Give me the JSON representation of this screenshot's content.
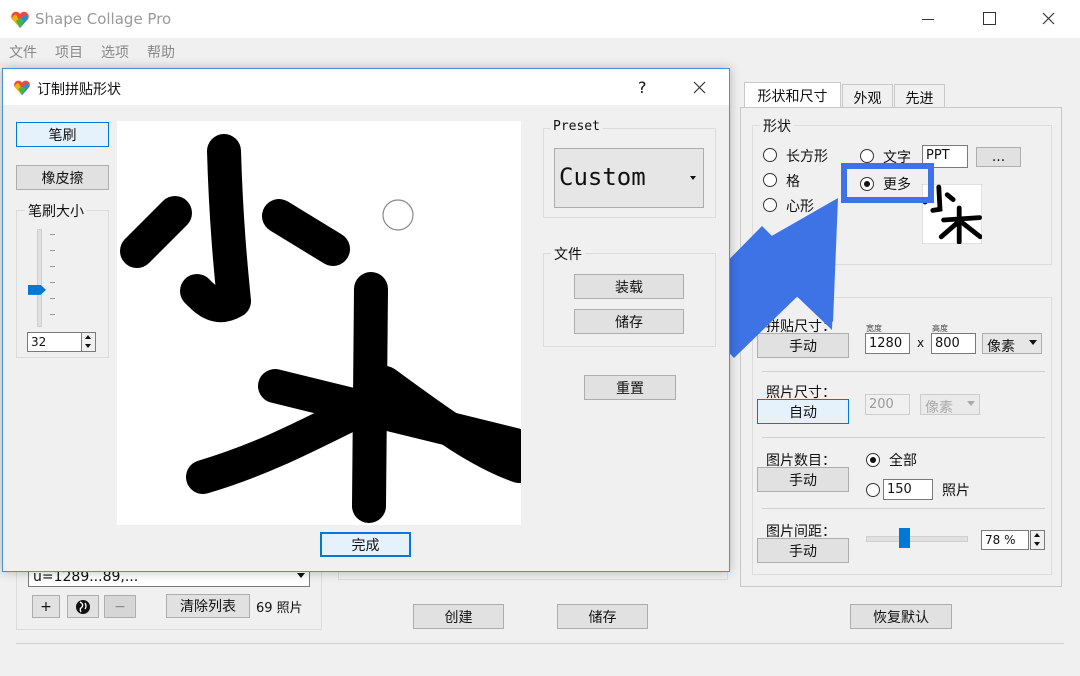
{
  "app": {
    "title": "Shape Collage Pro"
  },
  "menu": [
    "文件",
    "项目",
    "选项",
    "帮助"
  ],
  "tabs": [
    "形状和尺寸",
    "外观",
    "先进"
  ],
  "shape_group": {
    "title": "形状",
    "rect": "长方形",
    "grid": "格",
    "heart": "心形",
    "text": "文字",
    "text_value": "PPT",
    "browse": "...",
    "more": "更多"
  },
  "collage_size": {
    "label": "拼贴尺寸：",
    "mode": "手动",
    "width_caption": "宽度",
    "height_caption": "高度",
    "width": "1280",
    "x": "x",
    "height": "800",
    "unit": "像素"
  },
  "photo_size": {
    "label": "照片尺寸：",
    "mode": "自动",
    "value": "200",
    "unit": "像素"
  },
  "photo_count": {
    "label": "图片数目：",
    "mode": "手动",
    "all": "全部",
    "value": "150",
    "unit": "照片"
  },
  "spacing": {
    "label": "图片间距：",
    "mode": "手动",
    "value": "78 %",
    "level": 0.37
  },
  "bottom": {
    "create": "创建",
    "save": "储存",
    "restore": "恢复默认",
    "clear": "清除列表",
    "count": "69 照片",
    "plus": "+",
    "minus": "−",
    "path": "u=1289...89,..."
  },
  "dialog": {
    "title": "订制拼贴形状",
    "help": "?",
    "brush": "笔刷",
    "eraser": "橡皮擦",
    "brush_size_label": "笔刷大小",
    "brush_size": "32",
    "brush_level": 0.35,
    "preset_title": "Preset",
    "preset_value": "Custom",
    "file_title": "文件",
    "load": "装载",
    "save": "储存",
    "reset": "重置",
    "done": "完成"
  }
}
